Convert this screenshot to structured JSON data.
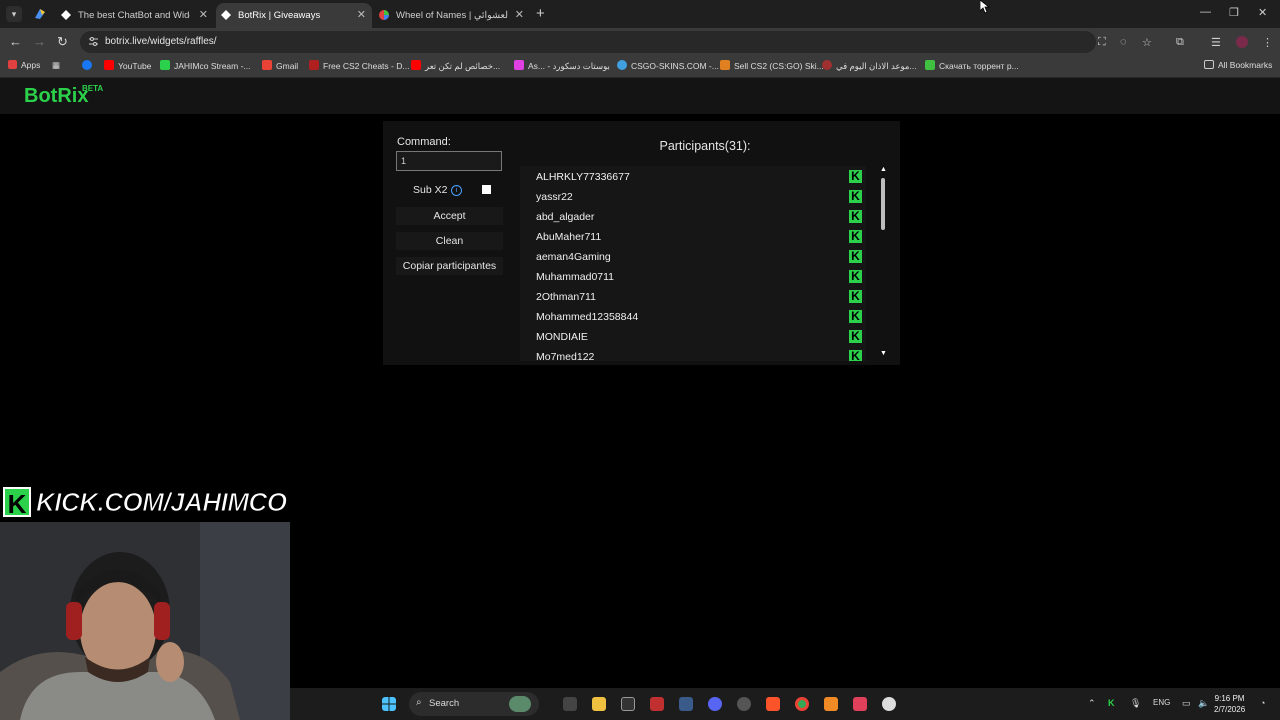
{
  "browser": {
    "tabs": [
      {
        "title": "The best ChatBot and Widgets",
        "active": false
      },
      {
        "title": "BotRix | Giveaways",
        "active": true
      },
      {
        "title": "Wheel of Names | عجلة الاسم العشوائي",
        "active": false
      }
    ],
    "url": "botrix.live/widgets/raffles/",
    "bookmarks": [
      {
        "label": "Apps",
        "color": "#e04040"
      },
      {
        "label": "YouTube",
        "color": "#ff0000"
      },
      {
        "label": "JAHIMco Stream -...",
        "color": "#2bd14a"
      },
      {
        "label": "Gmail",
        "color": "#ea4335"
      },
      {
        "label": "Free CS2 Cheats - D...",
        "color": "#b02020"
      },
      {
        "label": "خصائص لم تكن تعر...",
        "color": "#ff0000"
      },
      {
        "label": "As... - بوستات دسكورد",
        "color": "#e040e0"
      },
      {
        "label": "CSGO-SKINS.COM -...",
        "color": "#40a0e0"
      },
      {
        "label": "Sell CS2 (CS:GO) Ski...",
        "color": "#e08020"
      },
      {
        "label": "موعد الاذان اليوم في...",
        "color": "#a03030"
      },
      {
        "label": "Скачать торрент р...",
        "color": "#40c040"
      }
    ],
    "all_bookmarks": "All Bookmarks"
  },
  "site": {
    "logo": "BotRix",
    "badge": "BETA"
  },
  "raffle": {
    "command_label": "Command:",
    "command_value": "1",
    "sub_x2_label": "Sub X2",
    "sub_x2_checked": false,
    "accept_label": "Accept",
    "clean_label": "Clean",
    "copy_label": "Copiar participantes",
    "participants_title": "Participants(31):",
    "participants": [
      "ALHRKLY77336677",
      "yassr22",
      "abd_algader",
      "AbuMaher711",
      "aeman4Gaming",
      "Muhammad0711",
      "2Othman711",
      "Mohammed12358844",
      "MONDIAIE",
      "Mo7med122"
    ]
  },
  "overlay": {
    "kick_text": "KICK.COM/JAHIMCO"
  },
  "taskbar": {
    "search_label": "Search",
    "lang": "ENG",
    "time": "9:16 PM",
    "date": "2/7/2026"
  },
  "colors": {
    "accent": "#2bd14a",
    "page_bg": "#000000",
    "panel_bg": "#111111"
  }
}
